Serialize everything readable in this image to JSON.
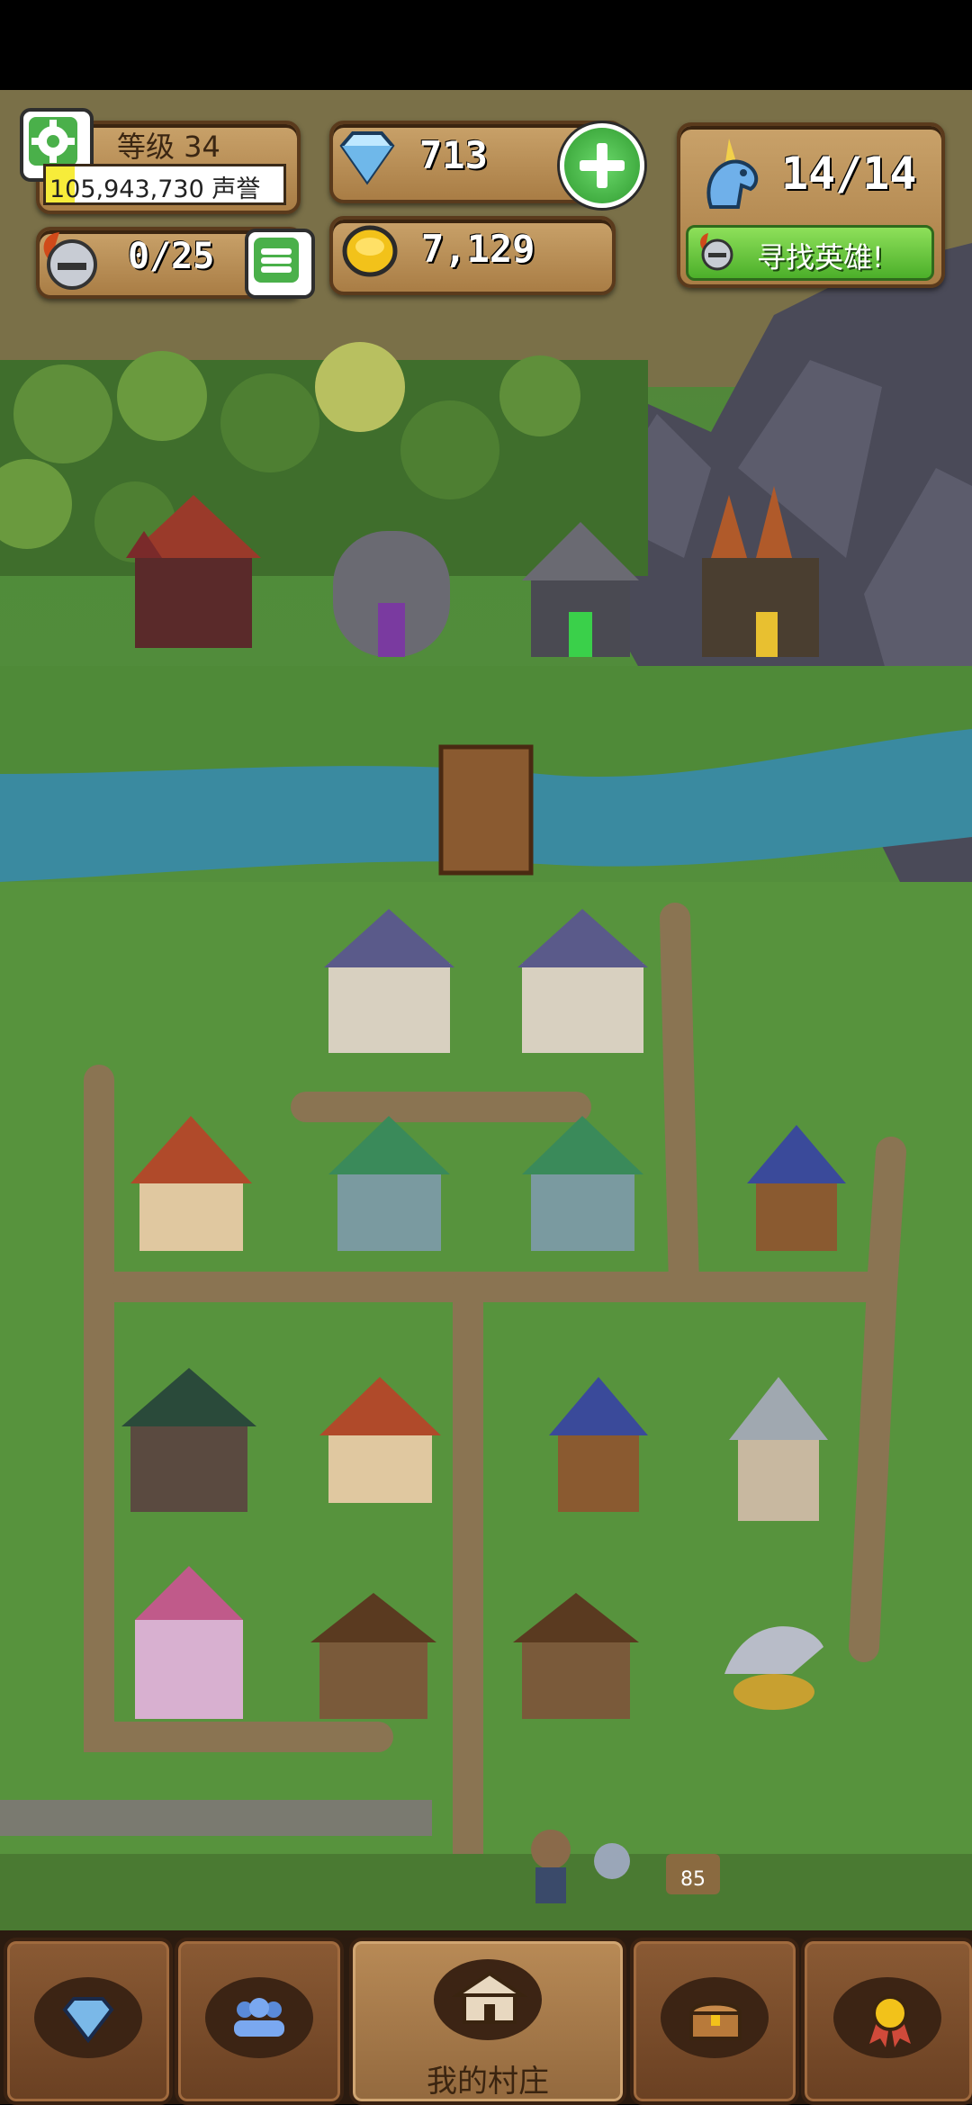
{
  "hud": {
    "level_label": "等级 34",
    "reputation_text": "105,943,730 声誉",
    "reputation_progress": 0.12,
    "gems": "713",
    "gold": "7,129",
    "heroes_capacity": "0/25",
    "unicorn_count": "14/14",
    "find_hero_label": "寻找英雄!"
  },
  "nav": {
    "tabs": [
      {
        "icon": "gem-icon",
        "label": ""
      },
      {
        "icon": "heroes-icon",
        "label": ""
      },
      {
        "icon": "village-icon",
        "label": "我的村庄",
        "active": true
      },
      {
        "icon": "chest-icon",
        "label": ""
      },
      {
        "icon": "medal-icon",
        "label": ""
      }
    ]
  },
  "map": {
    "bucket_count": "85"
  },
  "colors": {
    "panel_wood": "#b78a52",
    "grass": "#57933d",
    "river": "#3a8aa0",
    "button_green": "#4ab04a"
  }
}
